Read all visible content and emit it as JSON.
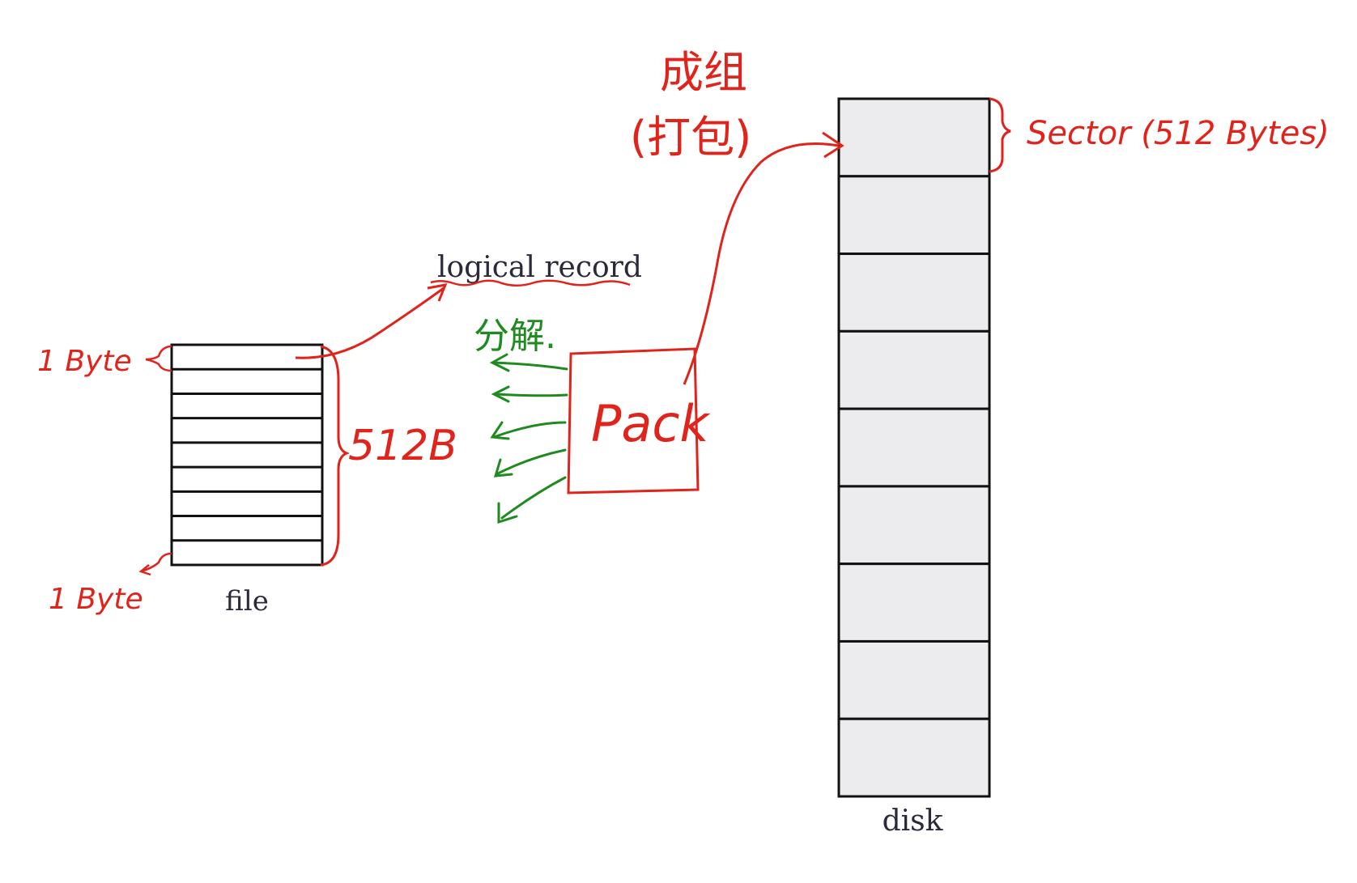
{
  "labels": {
    "file": "file",
    "disk": "disk",
    "logical_record": "logical record",
    "pack": "Pack",
    "byte_top": "1 Byte",
    "byte_bottom": "1 Byte",
    "block_size": "512B",
    "blocking": "成组",
    "packing": "(打包)",
    "splitting": "分解.",
    "sector": "Sector (512 Bytes)"
  },
  "file_rows": 9,
  "disk_sectors": 9,
  "colors": {
    "annotation_red": "#e0231b",
    "annotation_green": "#1f8a1f",
    "sector_fill": "#ececee",
    "outline": "#111111",
    "label_text": "#2a2a3a"
  }
}
